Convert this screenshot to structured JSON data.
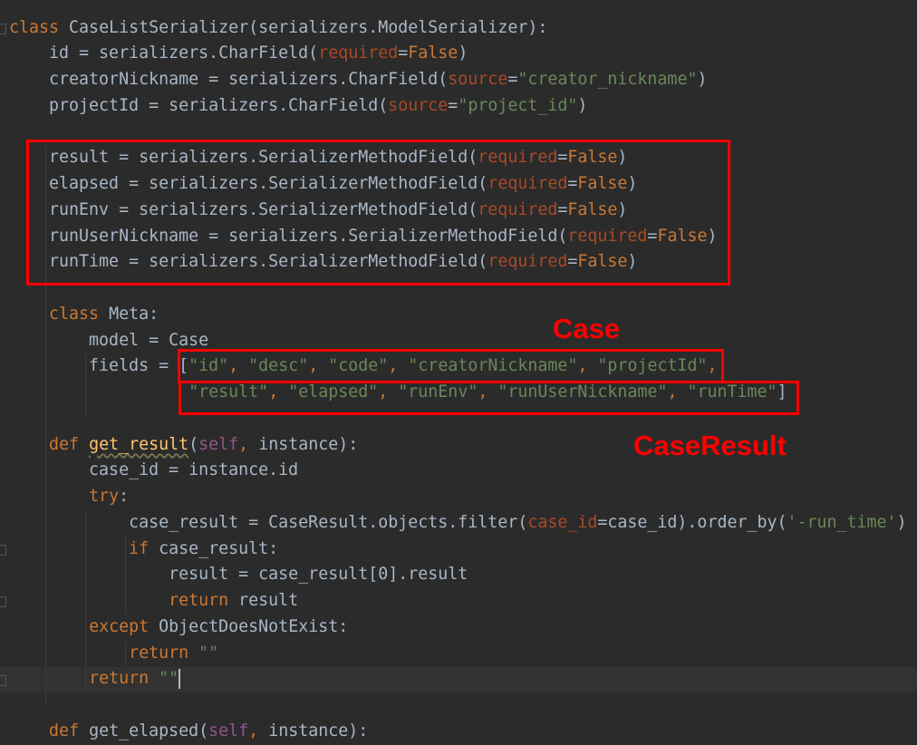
{
  "editor": {
    "colors": {
      "background": "#2b2b2b",
      "text": "#a9b7c6",
      "keyword": "#cc7832",
      "string": "#6a8759",
      "parameter": "#aa4926",
      "self": "#94558d",
      "function": "#ffc66d",
      "annotation": "#ff0000"
    },
    "current_line": 25,
    "lines": [
      [
        [
          "kw",
          "class "
        ],
        [
          "plain",
          "CaseListSerializer(serializers.ModelSerializer):"
        ]
      ],
      [
        [
          "plain",
          "    id = serializers.CharField("
        ],
        [
          "param",
          "required"
        ],
        [
          "plain",
          "="
        ],
        [
          "kw",
          "False"
        ],
        [
          "plain",
          ")"
        ]
      ],
      [
        [
          "plain",
          "    creatorNickname = serializers.CharField("
        ],
        [
          "param",
          "source"
        ],
        [
          "plain",
          "="
        ],
        [
          "str",
          "\"creator_nickname\""
        ],
        [
          "plain",
          ")"
        ]
      ],
      [
        [
          "plain",
          "    projectId = serializers.CharField("
        ],
        [
          "param",
          "source"
        ],
        [
          "plain",
          "="
        ],
        [
          "str",
          "\"project_id\""
        ],
        [
          "plain",
          ")"
        ]
      ],
      [],
      [
        [
          "plain",
          "    result = serializers.SerializerMethodField("
        ],
        [
          "param",
          "required"
        ],
        [
          "plain",
          "="
        ],
        [
          "kw",
          "False"
        ],
        [
          "plain",
          ")"
        ]
      ],
      [
        [
          "plain",
          "    elapsed = serializers.SerializerMethodField("
        ],
        [
          "param",
          "required"
        ],
        [
          "plain",
          "="
        ],
        [
          "kw",
          "False"
        ],
        [
          "plain",
          ")"
        ]
      ],
      [
        [
          "plain",
          "    runEnv = serializers.SerializerMethodField("
        ],
        [
          "param",
          "required"
        ],
        [
          "plain",
          "="
        ],
        [
          "kw",
          "False"
        ],
        [
          "plain",
          ")"
        ]
      ],
      [
        [
          "plain",
          "    runUserNickname = serializers.SerializerMethodField("
        ],
        [
          "param",
          "required"
        ],
        [
          "plain",
          "="
        ],
        [
          "kw",
          "False"
        ],
        [
          "plain",
          ")"
        ]
      ],
      [
        [
          "plain",
          "    runTime = serializers.SerializerMethodField("
        ],
        [
          "param",
          "required"
        ],
        [
          "plain",
          "="
        ],
        [
          "kw",
          "False"
        ],
        [
          "plain",
          ")"
        ]
      ],
      [],
      [
        [
          "plain",
          "    "
        ],
        [
          "kw",
          "class "
        ],
        [
          "plain",
          "Meta:"
        ]
      ],
      [
        [
          "plain",
          "        model = Case"
        ]
      ],
      [
        [
          "plain",
          "        fields = ["
        ],
        [
          "str",
          "\"id\""
        ],
        [
          "kw",
          ", "
        ],
        [
          "str",
          "\"desc\""
        ],
        [
          "kw",
          ", "
        ],
        [
          "str",
          "\"code\""
        ],
        [
          "kw",
          ", "
        ],
        [
          "str",
          "\"creatorNickname\""
        ],
        [
          "kw",
          ", "
        ],
        [
          "str",
          "\"projectId\""
        ],
        [
          "kw",
          ","
        ]
      ],
      [
        [
          "plain",
          "                  "
        ],
        [
          "str",
          "\"result\""
        ],
        [
          "kw",
          ", "
        ],
        [
          "str",
          "\"elapsed\""
        ],
        [
          "kw",
          ", "
        ],
        [
          "str",
          "\"runEnv\""
        ],
        [
          "kw",
          ", "
        ],
        [
          "str",
          "\"runUserNickname\""
        ],
        [
          "kw",
          ", "
        ],
        [
          "str",
          "\"runTime\""
        ],
        [
          "plain",
          "]"
        ]
      ],
      [],
      [
        [
          "plain",
          "    "
        ],
        [
          "kw",
          "def "
        ],
        [
          "fn",
          "get_result"
        ],
        [
          "plain",
          "("
        ],
        [
          "self",
          "self"
        ],
        [
          "kw",
          ", "
        ],
        [
          "plain",
          "instance):"
        ]
      ],
      [
        [
          "plain",
          "        case_id = instance.id"
        ]
      ],
      [
        [
          "plain",
          "        "
        ],
        [
          "kw",
          "try"
        ],
        [
          "plain",
          ":"
        ]
      ],
      [
        [
          "plain",
          "            case_result = CaseResult.objects.filter("
        ],
        [
          "param",
          "case_id"
        ],
        [
          "plain",
          "=case_id).order_by("
        ],
        [
          "str",
          "'-run_time'"
        ],
        [
          "plain",
          ")"
        ]
      ],
      [
        [
          "plain",
          "            "
        ],
        [
          "kw",
          "if "
        ],
        [
          "plain",
          "case_result:"
        ]
      ],
      [
        [
          "plain",
          "                result = case_result["
        ],
        [
          "plain",
          "0"
        ],
        [
          "plain",
          "].result"
        ]
      ],
      [
        [
          "plain",
          "                "
        ],
        [
          "kw",
          "return "
        ],
        [
          "plain",
          "result"
        ]
      ],
      [
        [
          "plain",
          "        "
        ],
        [
          "kw",
          "except "
        ],
        [
          "plain",
          "ObjectDoesNotExist:"
        ]
      ],
      [
        [
          "plain",
          "            "
        ],
        [
          "kw",
          "return "
        ],
        [
          "str",
          "\"\""
        ]
      ],
      [
        [
          "plain",
          "        "
        ],
        [
          "kw",
          "return "
        ],
        [
          "str",
          "\"\""
        ]
      ],
      [],
      [
        [
          "plain",
          "    "
        ],
        [
          "kw",
          "def "
        ],
        [
          "plain",
          "get_elapsed("
        ],
        [
          "self",
          "self"
        ],
        [
          "kw",
          ", "
        ],
        [
          "plain",
          "instance):"
        ]
      ]
    ]
  },
  "annotations": {
    "case_label": "Case",
    "case_result_label": "CaseResult"
  }
}
